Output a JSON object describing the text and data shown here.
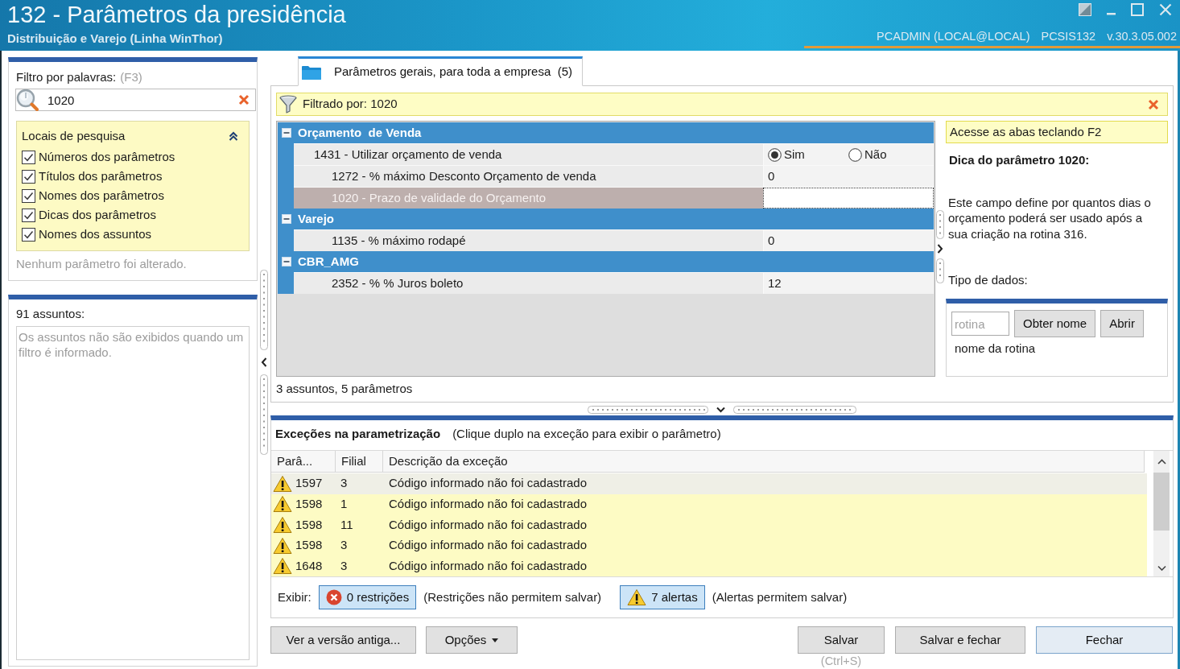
{
  "window": {
    "title": "132 - Parâmetros da presidência",
    "subtitle": "Distribuição e Varejo (Linha WinThor)",
    "user": "PCADMIN (LOCAL@LOCAL)",
    "routine": "PCSIS132",
    "version": "v.30.3.05.002"
  },
  "filter_panel": {
    "label": "Filtro por palavras:",
    "shortcut": "(F3)",
    "search": {
      "value": "1020"
    },
    "search_locations": {
      "title": "Locais de pesquisa",
      "expanded": true,
      "options": [
        {
          "label": "Números dos parâmetros",
          "checked": true
        },
        {
          "label": "Títulos dos parâmetros",
          "checked": true
        },
        {
          "label": "Nomes dos parâmetros",
          "checked": true
        },
        {
          "label": "Dicas dos parâmetros",
          "checked": true
        },
        {
          "label": "Nomes dos assuntos",
          "checked": true
        }
      ]
    },
    "status": "Nenhum parâmetro foi alterado."
  },
  "subjects_panel": {
    "count": "91 assuntos:",
    "message": "Os assuntos não são exibidos quando um filtro é informado."
  },
  "tabs": [
    {
      "label": "Parâmetros gerais, para toda a empresa  (5)",
      "selected": true
    }
  ],
  "filter_bar": {
    "text": "Filtrado por: 1020"
  },
  "parameter_grid": {
    "groups": [
      {
        "title": "Orçamento  de Venda",
        "expanded": true,
        "parameters": [
          {
            "kind": "choice",
            "label": "1431 - Utilizar orçamento de venda",
            "selected": false,
            "options": [
              {
                "label": "Sim",
                "selected": true
              },
              {
                "label": "Não",
                "selected": false
              }
            ]
          },
          {
            "kind": "text",
            "label": "1272 - % máximo Desconto Orçamento de venda",
            "value": "0",
            "selected": false
          },
          {
            "kind": "text",
            "label": "1020 - Prazo de validade do Orçamento",
            "selected": true
          }
        ]
      },
      {
        "title": "Varejo",
        "expanded": true,
        "parameters": [
          {
            "kind": "text",
            "label": "1135 - % máximo rodapé",
            "value": "0",
            "selected": false
          }
        ]
      },
      {
        "title": "CBR_AMG",
        "expanded": true,
        "parameters": [
          {
            "kind": "text",
            "label": "2352 - % % Juros boleto",
            "value": "12",
            "selected": false
          }
        ]
      }
    ],
    "status": "3 assuntos, 5 parâmetros"
  },
  "hint_panel": {
    "note": "Acesse as abas teclando F2",
    "title": "Dica do parâmetro 1020:",
    "description": "Este campo define por quantos dias o orçamento poderá ser usado após a sua criação na rotina 316.",
    "data_type_label": "Tipo de dados:"
  },
  "routine_lookup": {
    "placeholder": "rotina",
    "buttons": [
      "Obter nome",
      "Abrir"
    ],
    "result": "nome da rotina"
  },
  "exceptions": {
    "title": "Exceções na parametrização",
    "hint": "(Clique duplo na exceção para exibir o parâmetro)",
    "columns": [
      "Parâ...",
      "Filial",
      "Descrição da exceção"
    ],
    "rows": [
      {
        "kind": "alert",
        "parameter": "1597",
        "branch": "3",
        "description": "Código informado não foi cadastrado",
        "selected": true
      },
      {
        "kind": "alert",
        "parameter": "1598",
        "branch": "1",
        "description": "Código informado não foi cadastrado",
        "selected": false
      },
      {
        "kind": "alert",
        "parameter": "1598",
        "branch": "11",
        "description": "Código informado não foi cadastrado",
        "selected": false
      },
      {
        "kind": "alert",
        "parameter": "1598",
        "branch": "3",
        "description": "Código informado não foi cadastrado",
        "selected": false
      },
      {
        "kind": "alert",
        "parameter": "1648",
        "branch": "3",
        "description": "Código informado não foi cadastrado",
        "selected": false
      }
    ],
    "show_label": "Exibir:",
    "toggles": [
      {
        "kind": "restriction",
        "label": "0 restrições",
        "note": "(Restrições não permitem salvar)",
        "on": true
      },
      {
        "kind": "alert",
        "label": "7 alertas",
        "note": "(Alertas permitem salvar)",
        "on": true
      }
    ]
  },
  "footer": {
    "left_buttons": [
      {
        "kind": "plain",
        "label": "Ver a versão antiga...",
        "default": false
      },
      {
        "kind": "dropdown",
        "label": "Opções",
        "default": false
      }
    ],
    "right_buttons": [
      {
        "kind": "plain",
        "label": "Salvar",
        "shortcut": "(Ctrl+S)",
        "default": false
      },
      {
        "kind": "plain",
        "label": "Salvar e fechar",
        "default": false
      },
      {
        "kind": "plain",
        "label": "Fechar",
        "default": true
      }
    ]
  }
}
